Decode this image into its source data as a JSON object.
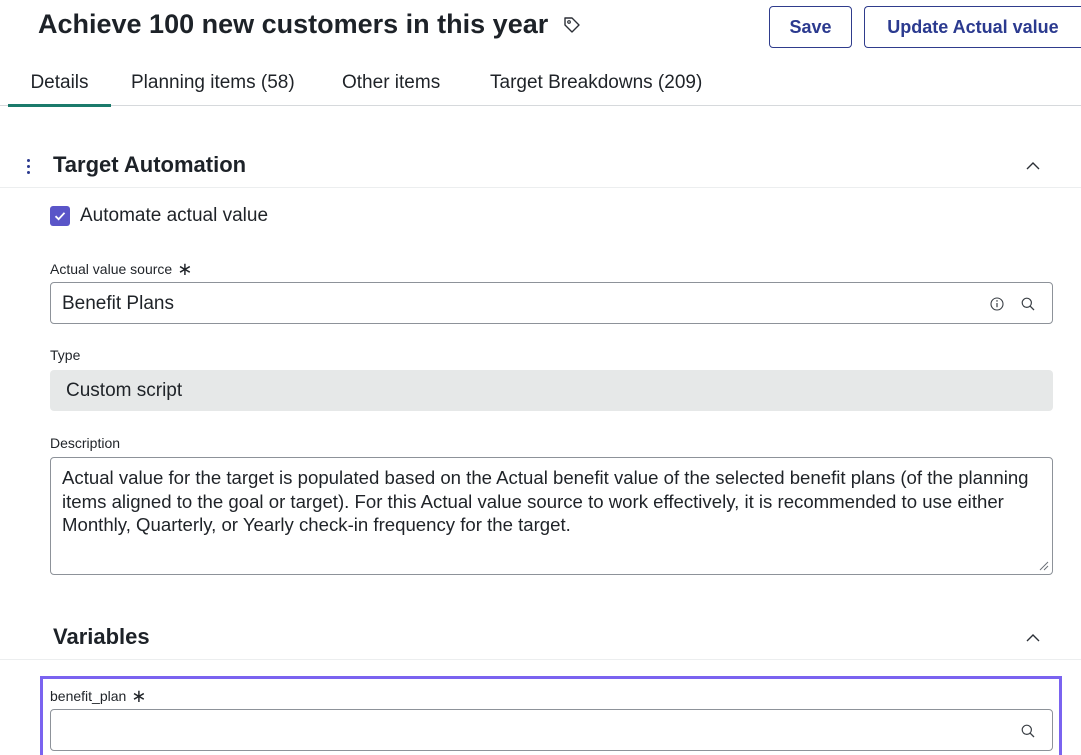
{
  "header": {
    "title": "Achieve 100 new customers in this year",
    "title_icon": "tag-icon",
    "save_label": "Save",
    "update_label": "Update Actual value"
  },
  "tabs": [
    {
      "label": "Details",
      "active": true
    },
    {
      "label": "Planning items (58)",
      "active": false
    },
    {
      "label": "Other items",
      "active": false
    },
    {
      "label": "Target Breakdowns (209)",
      "active": false
    }
  ],
  "target_automation": {
    "title": "Target Automation",
    "automate_label": "Automate actual value",
    "automate_checked": true,
    "actual_value_source": {
      "label": "Actual value source",
      "required_mark": "∗",
      "value": "Benefit Plans"
    },
    "type": {
      "label": "Type",
      "value": "Custom script"
    },
    "description": {
      "label": "Description",
      "value": "Actual value for the target is populated based on the Actual benefit value of the selected benefit plans (of the planning items aligned to the goal or target). For this Actual value source to work effectively, it is recommended to use either Monthly, Quarterly, or Yearly check-in frequency for the target."
    }
  },
  "variables": {
    "title": "Variables",
    "benefit_plan": {
      "label": "benefit_plan",
      "required_mark": "∗",
      "value": ""
    }
  },
  "colors": {
    "accent": "#2b3a8f",
    "tab_active_underline": "#1b7a6b",
    "checkbox": "#5a55c8",
    "highlight": "#7a63f0",
    "readonly_bg": "#e6e8e8"
  }
}
